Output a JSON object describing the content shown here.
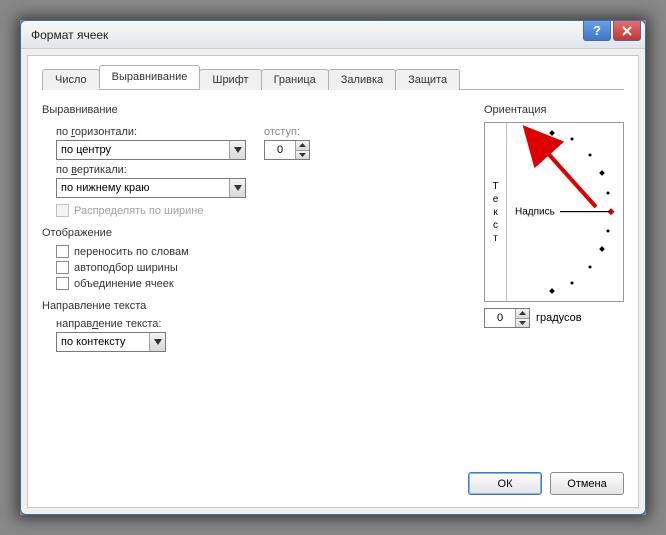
{
  "window": {
    "title": "Формат ячеек"
  },
  "tabs": [
    "Число",
    "Выравнивание",
    "Шрифт",
    "Граница",
    "Заливка",
    "Защита"
  ],
  "active_tab": 1,
  "groups": {
    "align": "Выравнивание",
    "display": "Отображение",
    "direction": "Направление текста",
    "orient": "Ориентация"
  },
  "align": {
    "h_label": "по горизонтали:",
    "h_value": "по центру",
    "v_label": "по вертикали:",
    "v_value": "по нижнему краю",
    "indent_label": "отступ:",
    "indent_value": "0",
    "distribute": "Распределять по ширине"
  },
  "display": {
    "wrap": "переносить по словам",
    "shrink": "автоподбор ширины",
    "merge": "объединение ячеек"
  },
  "direction": {
    "label": "направление текста:",
    "value": "по контексту"
  },
  "orient": {
    "vertical_text": "Текст",
    "word": "Надпись",
    "deg_value": "0",
    "deg_label": "градусов"
  },
  "buttons": {
    "ok": "ОК",
    "cancel": "Отмена"
  }
}
